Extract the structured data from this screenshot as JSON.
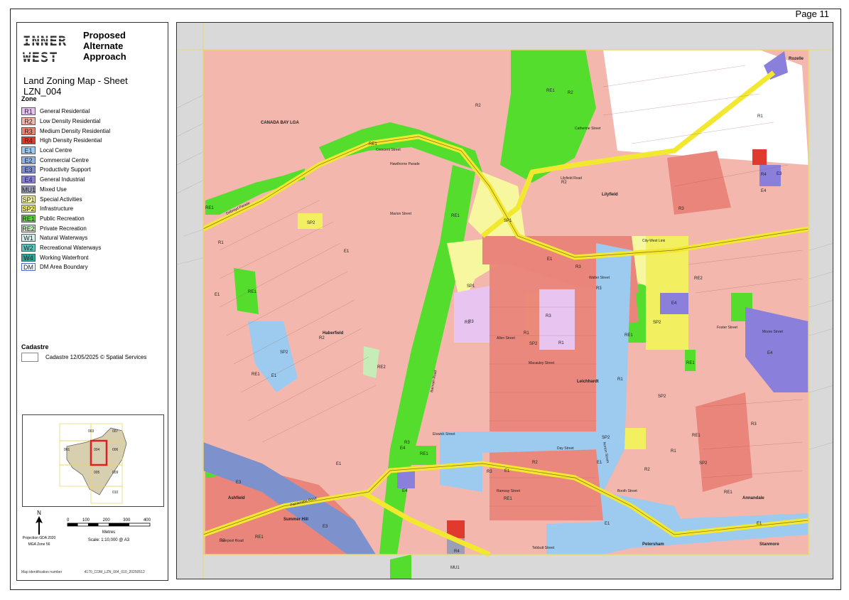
{
  "page": {
    "number": "Page 11"
  },
  "header": {
    "logo_text": [
      "INNER",
      "WEST"
    ],
    "title_lines": [
      "Proposed",
      "Alternate",
      "Approach"
    ],
    "map_title": "Land Zoning Map - Sheet LZN_004"
  },
  "legend": {
    "zone_heading": "Zone",
    "zones": [
      {
        "code": "R1",
        "label": "General Residential",
        "color": "#e8c4f0"
      },
      {
        "code": "R2",
        "label": "Low Density Residential",
        "color": "#f4b7ae"
      },
      {
        "code": "R3",
        "label": "Medium Density Residential",
        "color": "#e9857a"
      },
      {
        "code": "R4",
        "label": "High Density Residential",
        "color": "#e03a2f"
      },
      {
        "code": "E1",
        "label": "Local Centre",
        "color": "#9dcbf0"
      },
      {
        "code": "E2",
        "label": "Commercial Centre",
        "color": "#8fb3e6"
      },
      {
        "code": "E3",
        "label": "Productivity Support",
        "color": "#7d92cc"
      },
      {
        "code": "E4",
        "label": "General Industrial",
        "color": "#8a80dc"
      },
      {
        "code": "MU1",
        "label": "Mixed Use",
        "color": "#9a9fb5"
      },
      {
        "code": "SP1",
        "label": "Special Activities",
        "color": "#f7f7a0"
      },
      {
        "code": "SP2",
        "label": "Infrastructure",
        "color": "#f2f060"
      },
      {
        "code": "RE1",
        "label": "Public Recreation",
        "color": "#55dd2e"
      },
      {
        "code": "RE2",
        "label": "Private Recreation",
        "color": "#c6ecb8"
      },
      {
        "code": "W1",
        "label": "Natural Waterways",
        "color": "#d2f2ee"
      },
      {
        "code": "W2",
        "label": "Recreational Waterways",
        "color": "#5cc8c2"
      },
      {
        "code": "W4",
        "label": "Working Waterfront",
        "color": "#2aa89a"
      },
      {
        "code": "DM",
        "label": "DM Area Boundary",
        "color": "#ffffff"
      }
    ],
    "cadastre_heading": "Cadastre",
    "cadastre_label": "Cadastre 12/05/2025 © Spatial Services"
  },
  "inset": {
    "sheets": [
      "003",
      "007",
      "001",
      "004",
      "006",
      "005",
      "009",
      "010"
    ]
  },
  "north": {
    "letter": "N",
    "projection": "Projection GDA 2020",
    "zone": "MGA Zone 56"
  },
  "scale": {
    "ticks": [
      "0",
      "100",
      "200",
      "300",
      "400"
    ],
    "unit": "Metres",
    "ratio": "Scale: 1:10,000 @ A3"
  },
  "footer": {
    "id_label": "Map identification number",
    "id_value": "4170_COM_LZN_004_010_20250512"
  },
  "map": {
    "region_label": "CANADA BAY LGA",
    "suburbs": [
      "Haberfield",
      "Lilyfield",
      "Leichhardt",
      "Rozelle",
      "Ashfield",
      "Summer Hill",
      "Annandale",
      "Petersham",
      "Stanmore"
    ],
    "streets": [
      "City-West Link",
      "Parramatta Road",
      "Norton Street",
      "Balmain Road",
      "Marion Street",
      "Foster Street",
      "Moore Street",
      "Allen Street",
      "Day Street",
      "Hawthorne Parade",
      "Dobroyd Parade",
      "Liverpool Road",
      "Macauley Street",
      "Catherine Street",
      "Elswick Street",
      "Crescent Street",
      "Lilyfield Road",
      "Ramsay Street",
      "Walter Street",
      "Tebbutt Street",
      "Booth Street"
    ],
    "zone_labels": [
      "RE1",
      "RE1",
      "RE1",
      "RE1",
      "RE1",
      "RE1",
      "RE1",
      "RE1",
      "RE1",
      "RE1",
      "RE1",
      "RE1",
      "RE1",
      "RE2",
      "RE2",
      "SP1",
      "SP1",
      "SP2",
      "SP2",
      "SP2",
      "SP2",
      "SP2",
      "SP2",
      "SP2",
      "E1",
      "E1",
      "E1",
      "E1",
      "E1",
      "E1",
      "E1",
      "E1",
      "E1",
      "E3",
      "E3",
      "E3",
      "E4",
      "E4",
      "E4",
      "E4",
      "E4",
      "R1",
      "R1",
      "R1",
      "R1",
      "R1",
      "R1",
      "R1",
      "R2",
      "R2",
      "R2",
      "R2",
      "R2",
      "R2",
      "R2",
      "R3",
      "R3",
      "R3",
      "R3",
      "R3",
      "R3",
      "R3",
      "R3",
      "R4",
      "R4",
      "MU1"
    ]
  }
}
